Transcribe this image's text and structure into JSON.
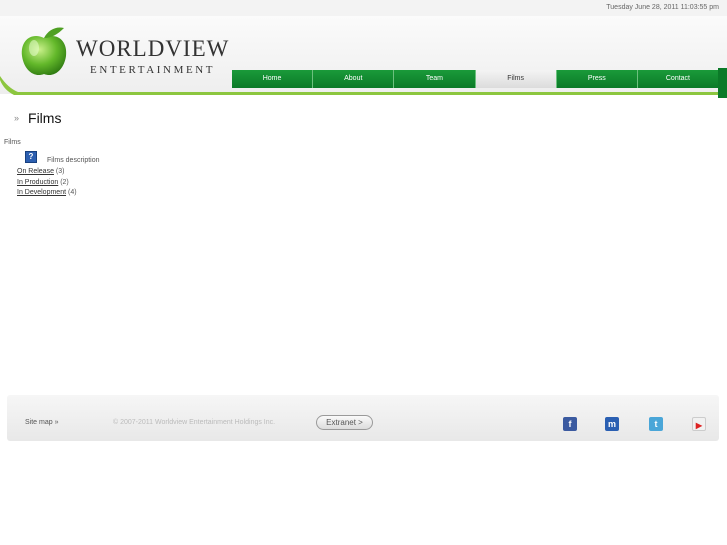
{
  "topbar": {
    "datetime": "Tuesday June 28, 2011 11:03:55 pm"
  },
  "brand": {
    "name": "WORLDVIEW",
    "sub": "ENTERTAINMENT"
  },
  "nav": {
    "items": [
      {
        "label": "Home"
      },
      {
        "label": "About"
      },
      {
        "label": "Team"
      },
      {
        "label": "Films"
      },
      {
        "label": "Press"
      },
      {
        "label": "Contact"
      }
    ],
    "active": "Films"
  },
  "page": {
    "raquo": "»",
    "title": "Films",
    "breadcrumb": "Films",
    "help_icon_glyph": "?",
    "description": "Films description",
    "categories": [
      {
        "label": "On Release",
        "count": "(3)"
      },
      {
        "label": "In Production",
        "count": "(2)"
      },
      {
        "label": "In Development",
        "count": "(4)"
      }
    ]
  },
  "footer": {
    "sitemap": "Site map »",
    "copyright": "© 2007-2011 Worldview Entertainment Holdings Inc.",
    "extranet": "Extranet  >",
    "social": [
      {
        "icon": "facebook-icon",
        "glyph": "f"
      },
      {
        "icon": "myspace-icon",
        "glyph": "m"
      },
      {
        "icon": "twitter-icon",
        "glyph": "t"
      },
      {
        "icon": "youtube-icon",
        "glyph": "▶"
      }
    ]
  },
  "colors": {
    "accent_green": "#0b7a28",
    "nav_active": "#e6e6e6",
    "link": "#333333"
  }
}
